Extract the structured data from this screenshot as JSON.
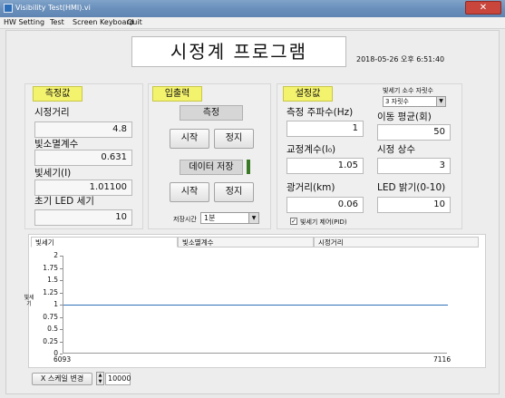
{
  "window": {
    "title": "Visibility Test(HMI).vi",
    "close": "✕"
  },
  "menu": [
    "HW Setting",
    "Test",
    "Screen Keyboard",
    "Quit"
  ],
  "header": {
    "title": "시정계 프로그램",
    "datetime": "2018-05-26 오후 6:51:40"
  },
  "measure": {
    "heading": "측정값",
    "fields": [
      {
        "label": "시정거리",
        "value": "4.8"
      },
      {
        "label": "빛소멸계수",
        "value": "0.631"
      },
      {
        "label": "빛세기(I)",
        "value": "1.01100"
      },
      {
        "label": "초기 LED 세기",
        "value": "10"
      }
    ]
  },
  "io": {
    "heading": "입출력",
    "measure_label": "측정",
    "start": "시작",
    "stop": "정지",
    "save_label": "데이터 저장",
    "start2": "시작",
    "stop2": "정지",
    "save_time_label": "저장시간",
    "save_time_value": "1분"
  },
  "settings": {
    "heading": "설정값",
    "decimal_label": "빛세기 소수 자릿수",
    "decimal_value": "3 자릿수",
    "freq_label": "측정 주파수(Hz)",
    "freq_value": "1",
    "avg_label": "이동 평균(회)",
    "avg_value": "50",
    "cal_label": "교정계수(I₀)",
    "cal_value": "1.05",
    "const_label": "시정 상수",
    "const_value": "3",
    "path_label": "광거리(km)",
    "path_value": "0.06",
    "led_label": "LED 밝기(0-10)",
    "led_value": "10",
    "pid_label": "빛세기 제어(PID)",
    "pid_checked": true
  },
  "graph": {
    "tabs": [
      "빛세기",
      "빛소멸계수",
      "시정거리"
    ],
    "y_axis_label": "빛세기",
    "yticks": [
      "2",
      "1.75",
      "1.5",
      "1.25",
      "1",
      "0.75",
      "0.5",
      "0.25",
      "0"
    ],
    "x_start": "6093",
    "x_end": "7116",
    "series_level": 1.0
  },
  "footer": {
    "xscale_button": "X 스케일 변경",
    "xscale_value": "10000"
  }
}
